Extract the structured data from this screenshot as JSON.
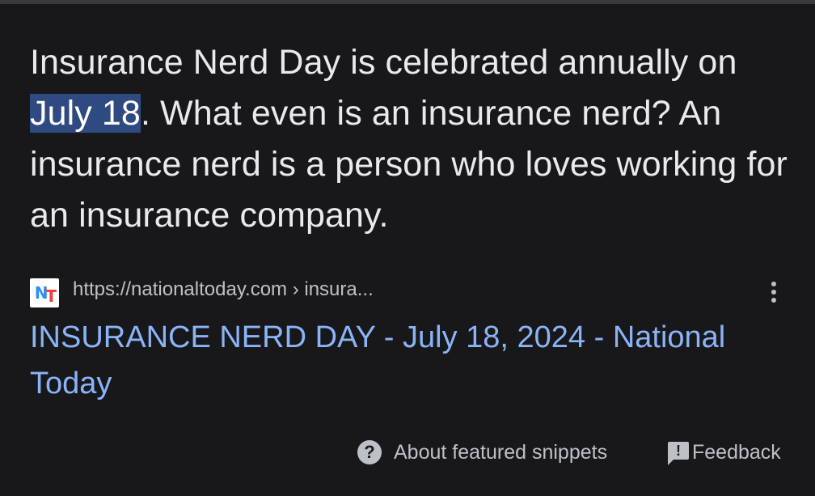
{
  "snippet": {
    "text_before": "Insurance Nerd Day is celebrated annually on ",
    "highlighted": "July 18",
    "text_after": ". What even is an insurance nerd? An insurance nerd is a person who loves working for an insurance company."
  },
  "source": {
    "favicon_letters": [
      "N",
      "T"
    ],
    "url": "https://nationaltoday.com › insura...",
    "more_icon": "more-vert-icon"
  },
  "result": {
    "title": "INSURANCE NERD DAY - July 18, 2024 - National Today"
  },
  "footer": {
    "about_icon": "help-icon",
    "about_label": "About featured snippets",
    "feedback_icon": "feedback-icon",
    "feedback_label": "Feedback"
  },
  "colors": {
    "background": "#18181a",
    "text": "#e8eaed",
    "highlight": "#2f4a80",
    "link": "#8ab4f8",
    "muted": "#bdc1c6"
  }
}
